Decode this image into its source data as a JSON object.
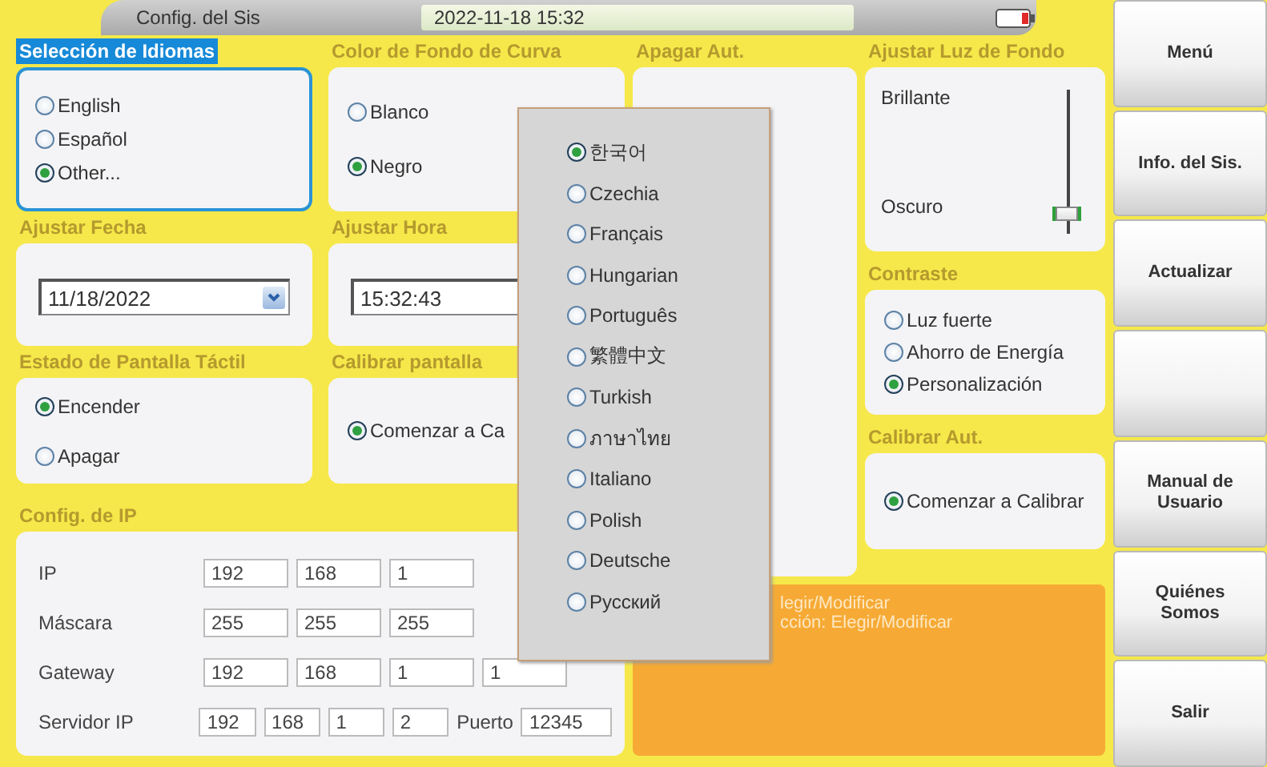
{
  "header": {
    "title": "Config. del Sis",
    "datetime": "2022-11-18 15:32"
  },
  "language": {
    "title": "Selección de Idiomas",
    "selected": true,
    "options": [
      {
        "label": "English",
        "selected": false
      },
      {
        "label": "Español",
        "selected": false
      },
      {
        "label": "Other...",
        "selected": true
      }
    ]
  },
  "curve_background": {
    "title": "Color de Fondo de Curva",
    "options": [
      {
        "label": "Blanco",
        "selected": false
      },
      {
        "label": "Negro",
        "selected": true
      }
    ]
  },
  "auto_off": {
    "title": "Apagar Aut."
  },
  "backlight": {
    "title": "Ajustar Luz de Fondo",
    "high_label": "Brillante",
    "low_label": "Oscuro",
    "level": 0.1
  },
  "date": {
    "title": "Ajustar Fecha",
    "value": "11/18/2022"
  },
  "time": {
    "title": "Ajustar Hora",
    "value": "15:32:43"
  },
  "contrast": {
    "title": "Contraste",
    "options": [
      {
        "label": "Luz fuerte",
        "selected": false
      },
      {
        "label": "Ahorro de Energía",
        "selected": false
      },
      {
        "label": "Personalización",
        "selected": true
      }
    ]
  },
  "touch": {
    "title": "Estado de Pantalla Táctil",
    "options": [
      {
        "label": "Encender",
        "selected": true
      },
      {
        "label": "Apagar",
        "selected": false
      }
    ]
  },
  "touch_calibration": {
    "title": "Calibrar pantalla",
    "options": [
      {
        "label": "Comenzar a Ca",
        "selected": true
      }
    ]
  },
  "auto_calibration": {
    "title": "Calibrar Aut.",
    "options": [
      {
        "label": "Comenzar a Calibrar",
        "selected": true
      }
    ]
  },
  "ip": {
    "title": "Config. de IP",
    "rows": [
      {
        "label": "IP",
        "fields": [
          "192",
          "168",
          "1"
        ]
      },
      {
        "label": "Máscara",
        "fields": [
          "255",
          "255",
          "255"
        ]
      },
      {
        "label": "Gateway",
        "fields": [
          "192",
          "168",
          "1",
          "1"
        ]
      },
      {
        "label": "Servidor IP",
        "fields": [
          "192",
          "168",
          "1",
          "2"
        ],
        "port_label": "Puerto",
        "port": "12345"
      }
    ]
  },
  "info": {
    "lines": [
      "legir/Modificar",
      "cción: Elegir/Modificar"
    ]
  },
  "language_popup": {
    "options": [
      {
        "label": "한국어",
        "selected": true
      },
      {
        "label": "Czechia",
        "selected": false
      },
      {
        "label": "Français",
        "selected": false
      },
      {
        "label": "Hungarian",
        "selected": false
      },
      {
        "label": "Português",
        "selected": false
      },
      {
        "label": "繁體中文",
        "selected": false
      },
      {
        "label": "Turkish",
        "selected": false
      },
      {
        "label": "ภาษาไทย",
        "selected": false
      },
      {
        "label": "Italiano",
        "selected": false
      },
      {
        "label": "Polish",
        "selected": false
      },
      {
        "label": "Deutsche",
        "selected": false
      },
      {
        "label": "Русский",
        "selected": false
      }
    ]
  },
  "side_menu": [
    {
      "kind": "button",
      "label": "Menú"
    },
    {
      "kind": "button",
      "label": "Info. del Sis."
    },
    {
      "kind": "button",
      "label": "Actualizar"
    },
    {
      "kind": "blank"
    },
    {
      "kind": "button",
      "label": "Manual de\nUsuario"
    },
    {
      "kind": "button",
      "label": "Quiénes\nSomos"
    },
    {
      "kind": "button",
      "label": "Salir"
    }
  ]
}
